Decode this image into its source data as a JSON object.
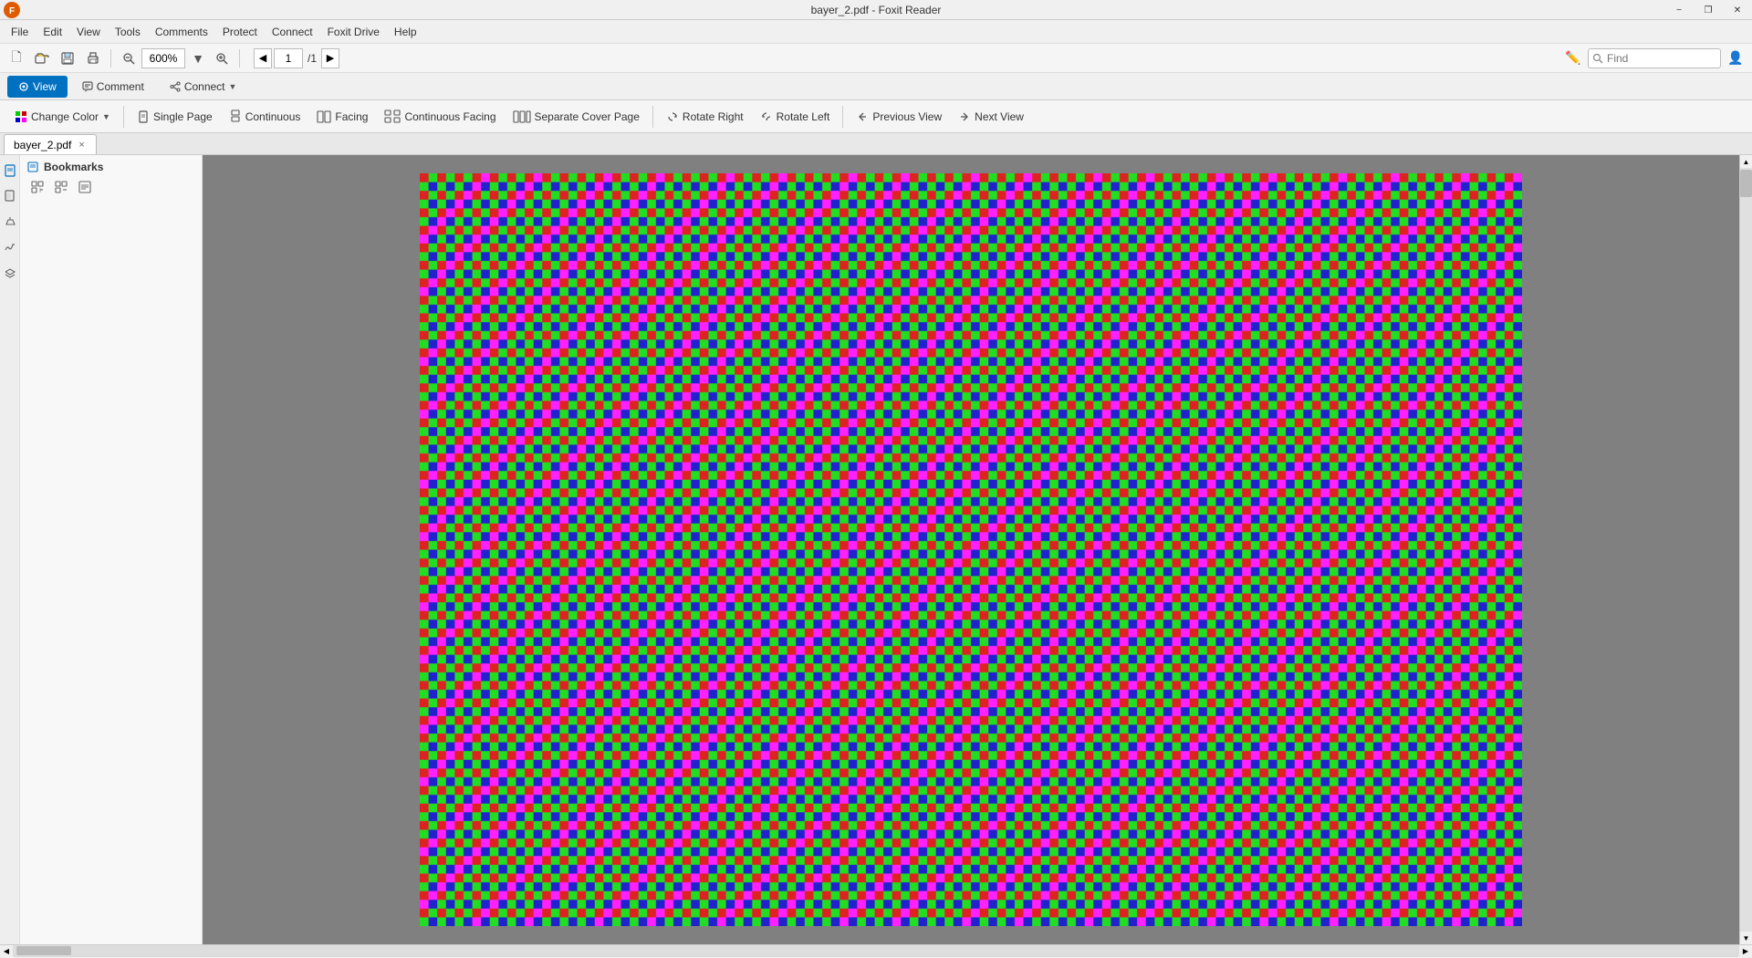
{
  "window": {
    "title": "bayer_2.pdf - Foxit Reader",
    "logo_color": "#e05a00"
  },
  "title_bar": {
    "title": "bayer_2.pdf - Foxit Reader",
    "minimize_label": "−",
    "restore_label": "❐",
    "close_label": "✕"
  },
  "menu": {
    "items": [
      "File",
      "Edit",
      "View",
      "Tools",
      "Comments",
      "Protect",
      "Connect",
      "Foxit Drive",
      "Help"
    ]
  },
  "toolbar": {
    "new_label": "🗋",
    "open_label": "📂",
    "save_label": "💾",
    "print_label": "🖨",
    "zoom_value": "600%",
    "zoom_in_label": "+",
    "zoom_out_label": "−",
    "page_current": "1",
    "page_total": "1",
    "nav_prev_label": "◀",
    "nav_next_label": "▶"
  },
  "tab_bar": {
    "view_label": "View",
    "comment_label": "Comment",
    "connect_label": "Connect",
    "find_placeholder": "Find"
  },
  "ribbon": {
    "change_color_label": "Change Color",
    "single_page_label": "Single Page",
    "continuous_label": "Continuous",
    "facing_label": "Facing",
    "continuous_facing_label": "Continuous Facing",
    "separate_cover_label": "Separate Cover Page",
    "rotate_right_label": "Rotate Right",
    "rotate_left_label": "Rotate Left",
    "previous_view_label": "Previous View",
    "next_view_label": "Next View"
  },
  "sidebar": {
    "bookmarks_label": "Bookmarks",
    "panel_icons": [
      "📖",
      "📎",
      "🔍"
    ]
  },
  "doc_tab": {
    "filename": "bayer_2.pdf",
    "close_label": "×"
  },
  "bayer": {
    "cell_size": 8,
    "colors": {
      "green": "#00cc00",
      "red": "#cc0000",
      "blue": "#0000cc",
      "magenta": "#ff00ff"
    }
  }
}
